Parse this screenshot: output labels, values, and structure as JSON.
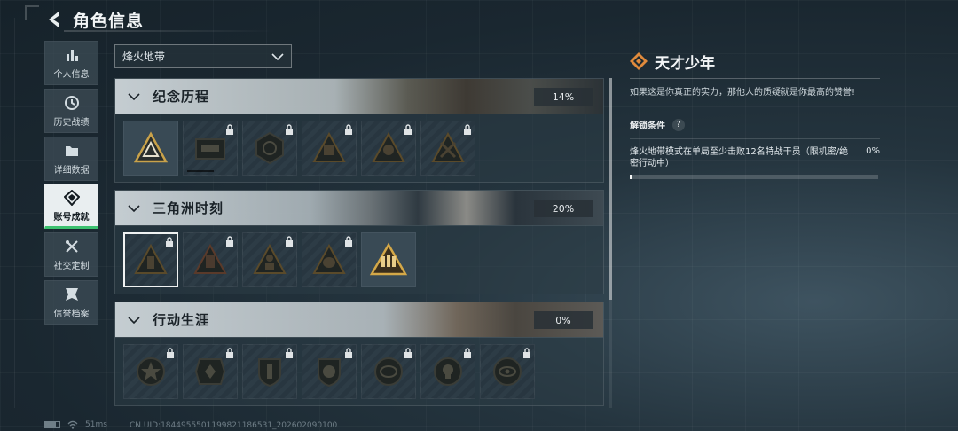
{
  "header": {
    "title": "角色信息"
  },
  "sidebar": {
    "items": [
      {
        "label": "个人信息",
        "icon": "bar-chart-icon",
        "active": false
      },
      {
        "label": "历史战绩",
        "icon": "history-icon",
        "active": false
      },
      {
        "label": "详细数据",
        "icon": "folder-icon",
        "active": false
      },
      {
        "label": "账号成就",
        "icon": "achievement-icon",
        "active": true
      },
      {
        "label": "社交定制",
        "icon": "tools-icon",
        "active": false
      },
      {
        "label": "信誉档案",
        "icon": "reputation-icon",
        "active": false
      }
    ]
  },
  "mode_select": {
    "value": "烽火地带"
  },
  "sections": [
    {
      "title": "纪念历程",
      "progress": "14%",
      "badges": [
        {
          "icon": "triangle-emblem-icon",
          "locked": false,
          "selected": false
        },
        {
          "icon": "vehicle-emblem-icon",
          "locked": true,
          "selected": false
        },
        {
          "icon": "shield-emblem-icon",
          "locked": true,
          "selected": false
        },
        {
          "icon": "helmet-emblem-icon",
          "locked": true,
          "selected": false
        },
        {
          "icon": "skull-emblem-icon",
          "locked": true,
          "selected": false
        },
        {
          "icon": "soldier-emblem-icon",
          "locked": true,
          "selected": false
        }
      ]
    },
    {
      "title": "三角洲时刻",
      "progress": "20%",
      "badges": [
        {
          "icon": "ammo-emblem-icon",
          "locked": true,
          "selected": true
        },
        {
          "icon": "canister-emblem-icon",
          "locked": true,
          "selected": false
        },
        {
          "icon": "operator-emblem-icon",
          "locked": true,
          "selected": false
        },
        {
          "icon": "mask-emblem-icon",
          "locked": true,
          "selected": false
        },
        {
          "icon": "squad-emblem-icon",
          "locked": false,
          "selected": false
        }
      ]
    },
    {
      "title": "行动生涯",
      "progress": "0%",
      "badges": [
        {
          "icon": "star-medal-icon",
          "locked": true,
          "selected": false
        },
        {
          "icon": "wing-medal-icon",
          "locked": true,
          "selected": false
        },
        {
          "icon": "crest-medal-icon",
          "locked": true,
          "selected": false
        },
        {
          "icon": "lion-medal-icon",
          "locked": true,
          "selected": false
        },
        {
          "icon": "globe-medal-icon",
          "locked": true,
          "selected": false
        },
        {
          "icon": "skull-medal-icon",
          "locked": true,
          "selected": false
        },
        {
          "icon": "eye-medal-icon",
          "locked": true,
          "selected": false
        }
      ]
    }
  ],
  "detail": {
    "title": "天才少年",
    "description": "如果这是你真正的实力，那他人的质疑就是你最高的赞誉!",
    "unlock_label": "解锁条件",
    "condition_text": "烽火地带模式在单局至少击败12名特战干员（限机密/绝密行动中）",
    "condition_pct": "0%",
    "condition_progress": 0
  },
  "footer": {
    "ping": "51ms",
    "uid": "CN UID:1844955501199821186531_202602090100"
  },
  "colors": {
    "accent_green": "#3cc16f",
    "gold": "#c9a24a",
    "detail_icon": "#e08a3c"
  }
}
